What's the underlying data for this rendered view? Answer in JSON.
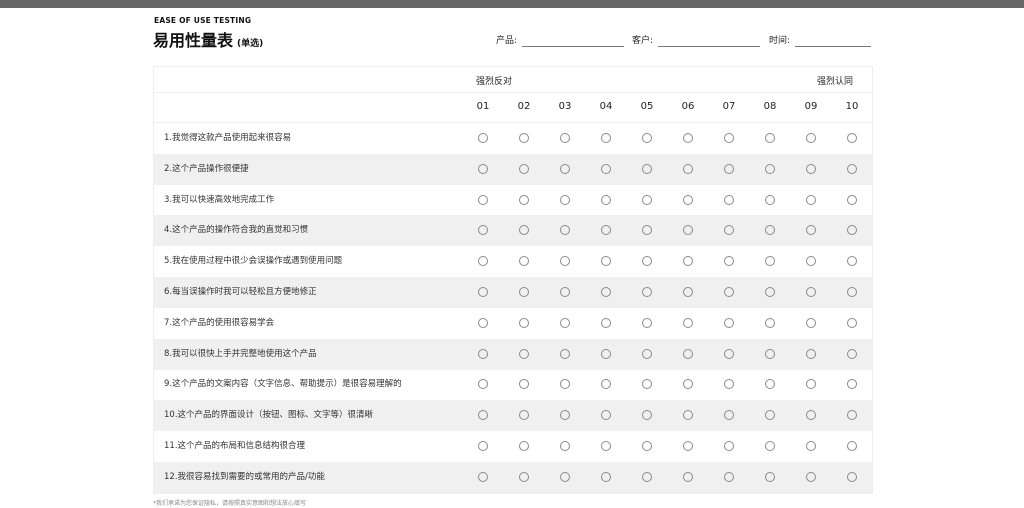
{
  "header": {
    "eyebrow": "EASE OF USE TESTING",
    "title": "易用性量表",
    "subtitle": "(单选)",
    "fields": [
      {
        "label": "产品:"
      },
      {
        "label": "客户:"
      },
      {
        "label": "时间:"
      }
    ]
  },
  "scale": {
    "left_label": "强烈反对",
    "right_label": "强烈认同",
    "options": [
      "01",
      "02",
      "03",
      "04",
      "05",
      "06",
      "07",
      "08",
      "09",
      "10"
    ]
  },
  "questions": [
    "1.我觉得这款产品使用起来很容易",
    "2.这个产品操作很便捷",
    "3.我可以快速高效地完成工作",
    "4.这个产品的操作符合我的直觉和习惯",
    "5.我在使用过程中很少会误操作或遇到使用问题",
    "6.每当误操作时我可以轻松且方便地修正",
    "7.这个产品的使用很容易学会",
    "8.我可以很快上手并完整地使用这个产品",
    "9.这个产品的文案内容（文字信息、帮助提示）是很容易理解的",
    "10.这个产品的界面设计（按钮、图标、文字等）很清晰",
    "11.这个产品的布局和信息结构很合理",
    "12.我很容易找到需要的或常用的产品/功能"
  ],
  "footnote": "*我们承诺为您保证隐私，请按照真实意图和想法放心填写",
  "colors": {
    "topbar": "#666666",
    "row_alt": "#f0f0f0",
    "radio_border": "#8a8a8a"
  }
}
